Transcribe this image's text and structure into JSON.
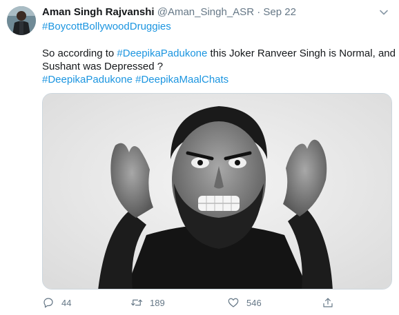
{
  "tweet": {
    "author_name": "Aman Singh Rajvanshi",
    "handle": "@Aman_Singh_ASR",
    "separator": "·",
    "date": "Sep 22",
    "header_hashtag": "#BoycottBollywoodDruggies",
    "text_part1": "So according to ",
    "text_hashtag1": "#DeepikaPadukone",
    "text_part2": " this Joker Ranveer Singh is Normal, and",
    "text_line2": "Sushant was Depressed ?",
    "hashtag_a": "#DeepikaPadukone",
    "hashtag_b": "#DeepikaMaalChats"
  },
  "actions": {
    "replies": "44",
    "retweets": "189",
    "likes": "546"
  },
  "icons": {
    "caret": "chevron-down-icon",
    "reply": "reply-icon",
    "retweet": "retweet-icon",
    "like": "heart-icon",
    "share": "share-icon"
  },
  "colors": {
    "link": "#1b95e0",
    "secondary": "#657786",
    "text": "#14171a"
  }
}
